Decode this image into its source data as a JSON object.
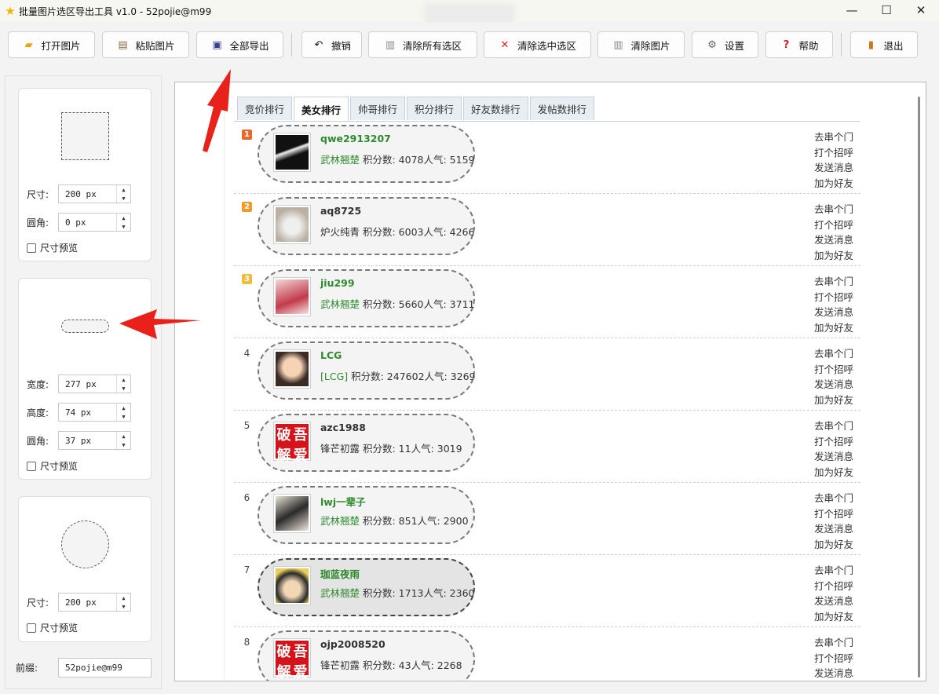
{
  "window": {
    "title": "批量图片选区导出工具 v1.0 - 52pojie@m99",
    "min": "—",
    "max": "☐",
    "close": "✕"
  },
  "toolbar": {
    "buttons": [
      {
        "label": "打开图片",
        "icon": "folder-icon",
        "glyph": "📂"
      },
      {
        "label": "粘贴图片",
        "icon": "clipboard-icon",
        "glyph": "📋"
      },
      {
        "label": "全部导出",
        "icon": "floppy-icon",
        "glyph": "💾"
      },
      {
        "label": "撤销",
        "icon": "undo-icon",
        "glyph": "↶"
      },
      {
        "label": "清除所有选区",
        "icon": "trash-icon",
        "glyph": "🗑"
      },
      {
        "label": "清除选中选区",
        "icon": "red-x-icon",
        "glyph": "✕"
      },
      {
        "label": "清除图片",
        "icon": "trash-icon",
        "glyph": "🗑"
      },
      {
        "label": "设置",
        "icon": "gear-icon",
        "glyph": "⚙"
      },
      {
        "label": "帮助",
        "icon": "question-icon",
        "glyph": "?"
      },
      {
        "label": "退出",
        "icon": "exit-door-icon",
        "glyph": "▮"
      }
    ]
  },
  "left": {
    "square": {
      "size_label": "尺寸:",
      "size_value": "200 px",
      "radius_label": "圆角:",
      "radius_value": "0 px",
      "preview": "尺寸预览"
    },
    "rect": {
      "width_label": "宽度:",
      "width_value": "277 px",
      "height_label": "高度:",
      "height_value": "74 px",
      "radius_label": "圆角:",
      "radius_value": "37 px",
      "preview": "尺寸预览"
    },
    "circle": {
      "size_label": "尺寸:",
      "size_value": "200 px",
      "preview": "尺寸预览"
    },
    "prefix_label": "前缀:",
    "prefix_value": "52pojie@m99"
  },
  "tabs": [
    "竞价排行",
    "美女排行",
    "帅哥排行",
    "积分排行",
    "好友数排行",
    "发帖数排行"
  ],
  "active_tab": "美女排行",
  "actions": [
    "去串个门",
    "打个招呼",
    "发送消息",
    "加为好友"
  ],
  "rows": [
    {
      "rank": "1",
      "name": "qwe2913207",
      "tag": "武林翘楚",
      "info": " 积分数: 4078人气: 5159",
      "name_color": "green"
    },
    {
      "rank": "2",
      "name": "aq8725",
      "tag": "",
      "info": "炉火纯青 积分数: 6003人气: 4266",
      "name_color": "dark"
    },
    {
      "rank": "3",
      "name": "jiu299",
      "tag": "武林翘楚",
      "info": " 积分数: 5660人气: 3711",
      "name_color": "green"
    },
    {
      "rank": "4",
      "name": "LCG",
      "tag": "[LCG]",
      "info": " 积分数: 247602人气: 3269",
      "name_color": "green"
    },
    {
      "rank": "5",
      "name": "azc1988",
      "tag": "",
      "info": "锋芒初露 积分数: 11人气: 3019",
      "name_color": "dark"
    },
    {
      "rank": "6",
      "name": "lwj一辈子",
      "tag": "武林翘楚",
      "info": " 积分数: 851人气: 2900",
      "name_color": "green"
    },
    {
      "rank": "7",
      "name": "珈蓝夜雨",
      "tag": "武林翘楚",
      "info": " 积分数: 1713人气: 2360",
      "name_color": "green"
    },
    {
      "rank": "8",
      "name": "ojp2008520",
      "tag": "",
      "info": "锋芒初露 积分数: 43人气: 2268",
      "name_color": "dark"
    }
  ],
  "seal_chars": [
    "破",
    "吾",
    "解",
    "爱"
  ],
  "colors": {
    "rank1": "#e8682a",
    "rank2": "#f09a2c",
    "rank3": "#f2bb3a",
    "accent_green": "#2f8a2f",
    "arrow_red": "#e8211b"
  }
}
